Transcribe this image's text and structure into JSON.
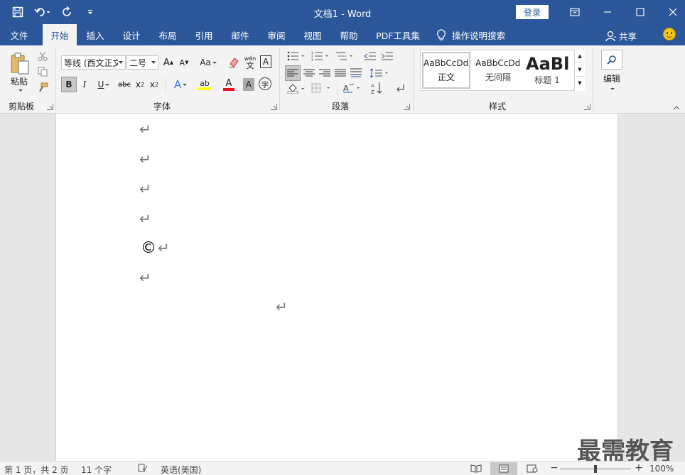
{
  "window": {
    "title": "文档1  -  Word",
    "login": "登录"
  },
  "tabs": [
    {
      "label": "文件"
    },
    {
      "label": "开始"
    },
    {
      "label": "插入"
    },
    {
      "label": "设计"
    },
    {
      "label": "布局"
    },
    {
      "label": "引用"
    },
    {
      "label": "邮件"
    },
    {
      "label": "审阅"
    },
    {
      "label": "视图"
    },
    {
      "label": "帮助"
    },
    {
      "label": "PDF工具集"
    }
  ],
  "active_tab": "开始",
  "search_tab": "操作说明搜索",
  "share": "共享",
  "ribbon": {
    "clipboard": {
      "paste": "粘贴",
      "label": "剪贴板"
    },
    "font": {
      "name": "等线 (西文正文)",
      "size": "二号",
      "grow": "A",
      "shrink": "A",
      "case": "Aa",
      "pinyin_top": "wén",
      "pinyin_bottom": "文",
      "border_char": "A",
      "bold": "B",
      "italic": "I",
      "underline": "U",
      "strike": "abc",
      "sub": "x",
      "sup": "x",
      "effect": "A",
      "highlight": "ab",
      "color": "A",
      "shade": "A",
      "enclose": "字",
      "label": "字体"
    },
    "paragraph": {
      "label": "段落"
    },
    "styles": {
      "items": [
        {
          "sample": "AaBbCcDd",
          "name": "正文"
        },
        {
          "sample": "AaBbCcDd",
          "name": "无间隔"
        },
        {
          "sample": "AaBl",
          "name": "标题 1"
        }
      ],
      "label": "样式"
    },
    "editing": {
      "label": "编辑"
    }
  },
  "document": {
    "para_mark": "↵",
    "copyright_char": "©"
  },
  "watermark": "最需教育",
  "status": {
    "page": "第 1 页，共 2 页",
    "words": "11 个字",
    "language": "英语(美国)",
    "zoom": "100%",
    "zoom_minus": "−",
    "zoom_plus": "+"
  },
  "colors": {
    "brand": "#2b579a",
    "highlight_yellow": "#ffff00",
    "font_red": "#e81123"
  }
}
